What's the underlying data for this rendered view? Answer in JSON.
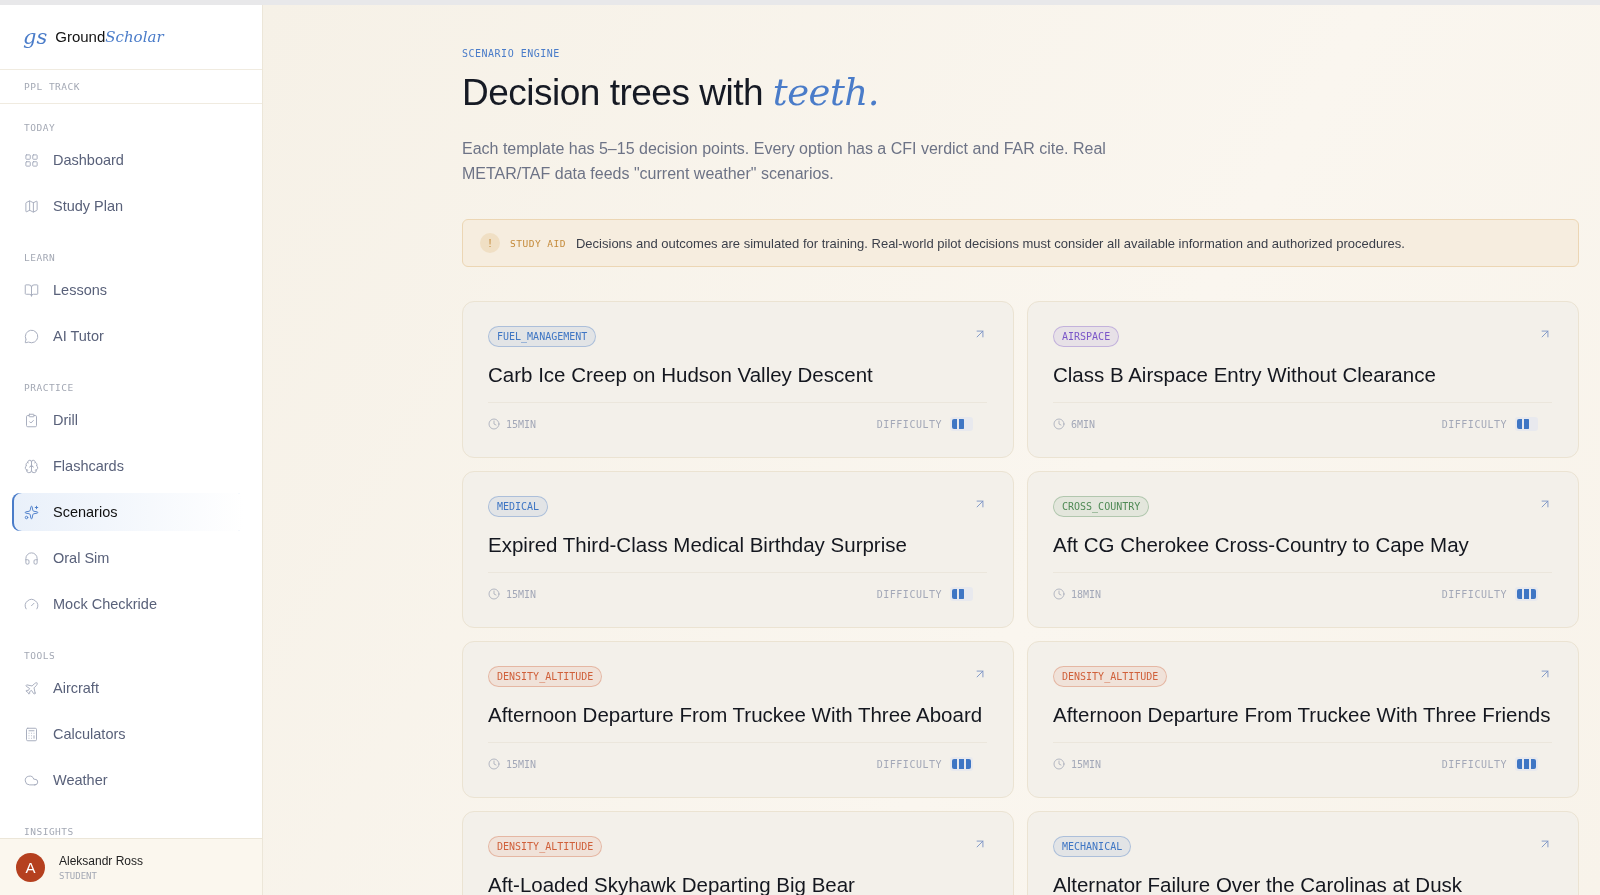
{
  "brand": {
    "mark": "gs",
    "name": "Ground",
    "name_accent": "Scholar"
  },
  "track": "PPL TRACK",
  "sidebar": {
    "sections": [
      {
        "title": "TODAY",
        "items": [
          {
            "label": "Dashboard",
            "selected": false
          },
          {
            "label": "Study Plan",
            "selected": false
          }
        ]
      },
      {
        "title": "LEARN",
        "items": [
          {
            "label": "Lessons",
            "selected": false
          },
          {
            "label": "AI Tutor",
            "selected": false
          }
        ]
      },
      {
        "title": "PRACTICE",
        "items": [
          {
            "label": "Drill",
            "selected": false
          },
          {
            "label": "Flashcards",
            "selected": false
          },
          {
            "label": "Scenarios",
            "selected": true
          },
          {
            "label": "Oral Sim",
            "selected": false
          },
          {
            "label": "Mock Checkride",
            "selected": false
          }
        ]
      },
      {
        "title": "TOOLS",
        "items": [
          {
            "label": "Aircraft",
            "selected": false
          },
          {
            "label": "Calculators",
            "selected": false
          },
          {
            "label": "Weather",
            "selected": false
          }
        ]
      },
      {
        "title": "INSIGHTS"
      }
    ]
  },
  "user": {
    "initial": "A",
    "name": "Aleksandr Ross",
    "role": "STUDENT"
  },
  "header": {
    "eyebrow": "SCENARIO ENGINE",
    "title": "Decision trees with ",
    "title_accent": "teeth.",
    "description": "Each template has 5–15 decision points. Every option has a CFI verdict and FAR cite. Real METAR/TAF data feeds \"current weather\" scenarios."
  },
  "notice": {
    "icon": "!",
    "label": "STUDY AID",
    "text": "Decisions and outcomes are simulated for training. Real-world pilot decisions must consider all available information and authorized procedures."
  },
  "scenarios": [
    {
      "tag": "FUEL_MANAGEMENT",
      "color": "#3f76c4",
      "title": "Carb Ice Creep on Hudson Valley Descent",
      "duration": "15MIN",
      "difficulty_label": "DIFFICULTY",
      "level": 0.67
    },
    {
      "tag": "AIRSPACE",
      "color": "#7a55c8",
      "title": "Class B Airspace Entry Without Clearance",
      "duration": "6MIN",
      "difficulty_label": "DIFFICULTY",
      "level": 0.67
    },
    {
      "tag": "MEDICAL",
      "color": "#3f76c4",
      "title": "Expired Third-Class Medical Birthday Surprise",
      "duration": "15MIN",
      "difficulty_label": "DIFFICULTY",
      "level": 0.67
    },
    {
      "tag": "CROSS_COUNTRY",
      "color": "#4f8a55",
      "title": "Aft CG Cherokee Cross-Country to Cape May",
      "duration": "18MIN",
      "difficulty_label": "DIFFICULTY",
      "level": 1
    },
    {
      "tag": "DENSITY_ALTITUDE",
      "color": "#d0603a",
      "title": "Afternoon Departure From Truckee With Three Aboard",
      "duration": "15MIN",
      "difficulty_label": "DIFFICULTY",
      "level": 1
    },
    {
      "tag": "DENSITY_ALTITUDE",
      "color": "#d0603a",
      "title": "Afternoon Departure From Truckee With Three Friends",
      "duration": "15MIN",
      "difficulty_label": "DIFFICULTY",
      "level": 1
    },
    {
      "tag": "DENSITY_ALTITUDE",
      "color": "#d0603a",
      "title": "Aft-Loaded Skyhawk Departing Big Bear"
    },
    {
      "tag": "MECHANICAL",
      "color": "#3f76c4",
      "title": "Alternator Failure Over the Carolinas at Dusk"
    }
  ]
}
